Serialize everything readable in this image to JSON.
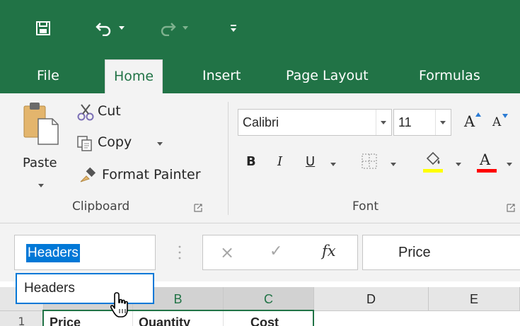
{
  "window": {
    "accent_color": "#217346",
    "quick_access": {
      "save_icon": "save-icon",
      "undo_icon": "undo-icon",
      "redo_icon": "redo-icon",
      "customize_icon": "customize-qat-icon"
    }
  },
  "tabs": [
    {
      "label": "File",
      "active": false
    },
    {
      "label": "Home",
      "active": true
    },
    {
      "label": "Insert",
      "active": false
    },
    {
      "label": "Page Layout",
      "active": false
    },
    {
      "label": "Formulas",
      "active": false
    }
  ],
  "ribbon": {
    "clipboard": {
      "label": "Clipboard",
      "paste": "Paste",
      "cut": "Cut",
      "copy": "Copy",
      "format_painter": "Format Painter"
    },
    "font": {
      "label": "Font",
      "font_name": "Calibri",
      "font_size": "11",
      "bold": "B",
      "italic": "I",
      "underline": "U",
      "grow_font": "A",
      "shrink_font": "A",
      "font_color_letter": "A",
      "fill_color": "#ffff00",
      "font_color": "#ff0000"
    }
  },
  "formula_bar": {
    "name_box_value": "Headers",
    "cancel": "×",
    "enter": "✓",
    "fx": "fx",
    "formula_value": "Price"
  },
  "name_dropdown": {
    "items": [
      "Headers"
    ]
  },
  "grid": {
    "columns": [
      "B",
      "C",
      "D",
      "E"
    ],
    "row_number": "1",
    "cells": [
      "Price",
      "Quantity",
      "Cost"
    ]
  }
}
